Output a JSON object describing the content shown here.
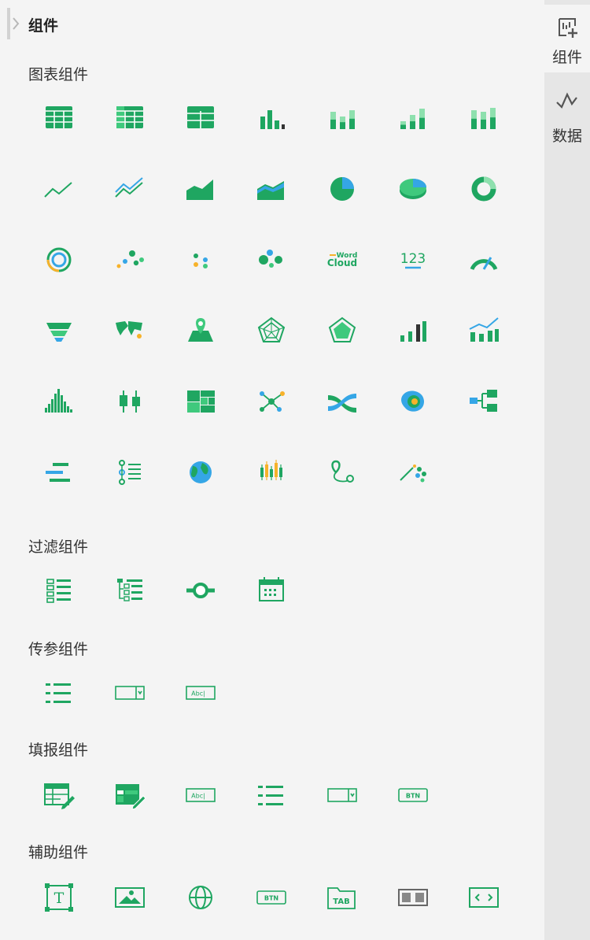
{
  "panel": {
    "title": "组件"
  },
  "sections": [
    {
      "title": "图表组件",
      "icons": [
        "grid-table-icon",
        "cross-table-icon",
        "freestyle-table-icon",
        "bar-chart-icon",
        "stacked-bar-chart-icon",
        "3d-bar-chart-icon",
        "3d-stacked-bar-chart-icon",
        "line-chart-icon",
        "multi-line-chart-icon",
        "area-chart-icon",
        "stacked-area-chart-icon",
        "pie-chart-icon",
        "3d-pie-chart-icon",
        "donut-chart-icon",
        "multi-ring-chart-icon",
        "scatter-chart-icon",
        "dot-chart-icon",
        "bubble-chart-icon",
        "word-cloud-icon",
        "number-card-icon",
        "gauge-chart-icon",
        "funnel-chart-icon",
        "world-map-icon",
        "map-pin-icon",
        "radar-chart-icon",
        "filled-radar-chart-icon",
        "rising-bar-chart-icon",
        "combo-chart-icon",
        "histogram-icon",
        "box-plot-icon",
        "treemap-icon",
        "network-graph-icon",
        "sankey-icon",
        "heatmap-icon",
        "tree-chart-icon",
        "gantt-chart-icon",
        "list-detail-icon",
        "globe-icon",
        "candlestick-chart-icon",
        "route-map-icon",
        "smart-chart-icon"
      ]
    },
    {
      "title": "过滤组件",
      "icons": [
        "list-filter-icon",
        "tree-filter-icon",
        "slider-filter-icon",
        "date-filter-icon"
      ]
    },
    {
      "title": "传参组件",
      "icons": [
        "param-list-icon",
        "param-dropdown-icon",
        "param-text-input-icon"
      ]
    },
    {
      "title": "填报组件",
      "icons": [
        "fill-table-icon",
        "fill-free-table-icon",
        "fill-text-input-icon",
        "fill-list-icon",
        "fill-dropdown-icon",
        "fill-button-icon"
      ]
    },
    {
      "title": "辅助组件",
      "icons": [
        "text-box-icon",
        "image-icon",
        "web-icon",
        "button-icon",
        "tab-container-icon",
        "blank-container-icon",
        "embed-code-icon"
      ]
    }
  ],
  "icon_text": {
    "word_cloud_top": "Word",
    "word_cloud_bottom": "Cloud",
    "number_card": "123",
    "input_abc": "Abc|",
    "button": "BTN",
    "tab": "TAB",
    "textbox": "T"
  },
  "rail": {
    "tabs": [
      {
        "label": "组件",
        "icon": "component-add-icon",
        "active": true
      },
      {
        "label": "数据",
        "icon": "data-line-icon",
        "active": false
      }
    ]
  },
  "colors": {
    "primary": "#1fa661",
    "light": "#3fc97d",
    "pale": "#8ee0ae",
    "blue": "#35a6e6",
    "orange": "#f7b22a",
    "panel_bg": "#f4f4f4",
    "rail_bg": "#e6e6e6"
  }
}
